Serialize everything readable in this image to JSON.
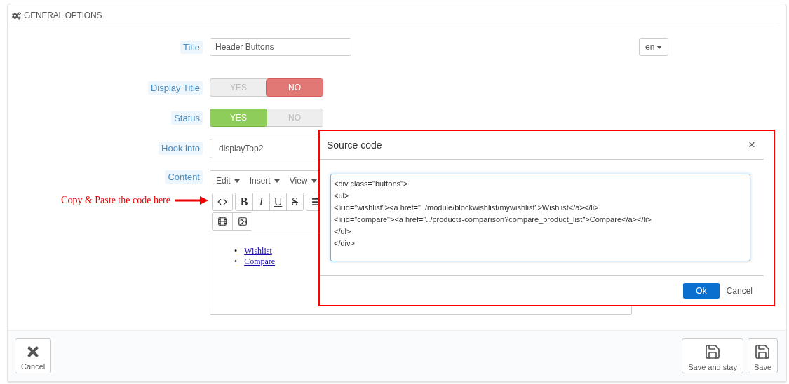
{
  "panel": {
    "title": "GENERAL OPTIONS"
  },
  "fields": [
    {
      "kind": "text",
      "label": "Title",
      "value": "Header Buttons",
      "language": "en"
    },
    {
      "kind": "toggle",
      "label": "Display Title",
      "options": [
        {
          "label": "YES",
          "selected": false
        },
        {
          "label": "NO",
          "selected": true
        }
      ]
    },
    {
      "kind": "toggle",
      "label": "Status",
      "options": [
        {
          "label": "YES",
          "selected": true
        },
        {
          "label": "NO",
          "selected": false
        }
      ]
    },
    {
      "kind": "select",
      "label": "Hook into",
      "value": "displayTop2"
    },
    {
      "kind": "editor",
      "label": "Content",
      "menus": [
        "Edit",
        "Insert",
        "View"
      ],
      "toolbar_rows": [
        [
          [
            {
              "kind": "code"
            }
          ],
          [
            {
              "kind": "bold",
              "text": "B"
            },
            {
              "kind": "italic",
              "text": "I"
            },
            {
              "kind": "underline",
              "text": "U"
            },
            {
              "kind": "strike",
              "text": "S"
            }
          ],
          [
            {
              "kind": "align"
            }
          ]
        ],
        [
          [
            {
              "kind": "video"
            },
            {
              "kind": "image"
            }
          ]
        ]
      ],
      "links": [
        {
          "marker": "•",
          "text": "Wishlist"
        },
        {
          "marker": "•",
          "text": "Compare"
        }
      ]
    }
  ],
  "annotation": "Copy & Paste the code here",
  "modal": {
    "title": "Source code",
    "close": "×",
    "code": "<div class=\"buttons\">\n<ul>\n<li id=\"wishlist\"><a href=\"../module/blockwishlist/mywishlist\">Wishlist</a></li>\n<li id=\"compare\"><a href=\"../products-comparison?compare_product_list\">Compare</a></li>\n</ul>\n</div>",
    "buttons": [
      {
        "label": "Ok",
        "kind": "primary"
      },
      {
        "label": "Cancel",
        "kind": "link"
      }
    ]
  },
  "footer": {
    "left": [
      {
        "label": "Cancel",
        "kind": "cancel"
      }
    ],
    "right": [
      {
        "label": "Save and stay",
        "kind": "save"
      },
      {
        "label": "Save",
        "kind": "save"
      }
    ]
  }
}
